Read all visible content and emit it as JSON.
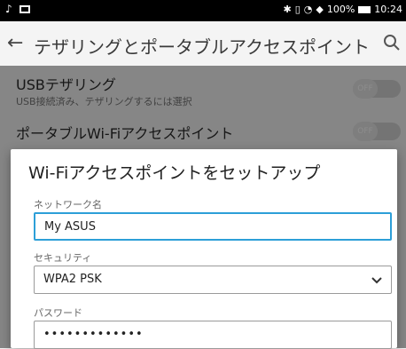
{
  "status_bar": {
    "battery_text": "100%",
    "time": "10:24"
  },
  "app_bar": {
    "title": "テザリングとポータブルアクセスポイント"
  },
  "rows": [
    {
      "title": "USBテザリング",
      "subtitle": "USB接続済み、テザリングするには選択",
      "toggle": "OFF"
    },
    {
      "title": "ポータブルWi-Fiアクセスポイント",
      "toggle": "OFF"
    }
  ],
  "dialog": {
    "title": "Wi-Fiアクセスポイントをセットアップ",
    "network_label": "ネットワーク名",
    "network_value": "My ASUS",
    "security_label": "セキュリティ",
    "security_value": "WPA2 PSK",
    "password_label": "パスワード",
    "password_value": "•••••••••••••"
  }
}
